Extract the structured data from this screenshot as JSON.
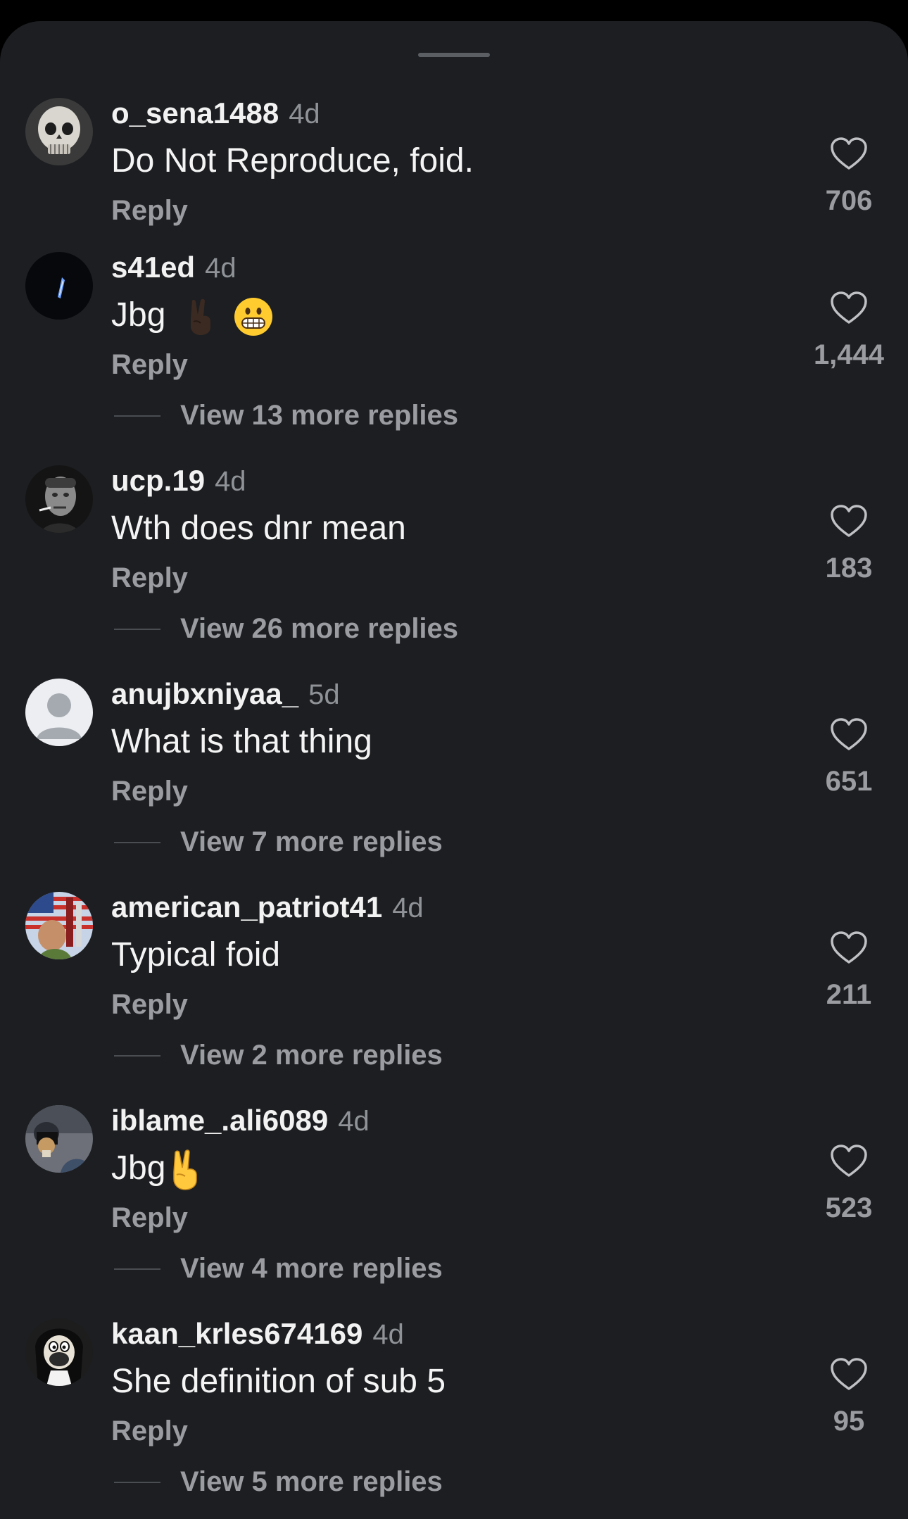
{
  "comments": [
    {
      "username": "o_sena1488",
      "age": "4d",
      "text": "Do Not Reproduce, foid.",
      "reply": "Reply",
      "likes": "706",
      "more": ""
    },
    {
      "username": "s41ed",
      "age": "4d",
      "text": "Jbg",
      "reply": "Reply",
      "likes": "1,444",
      "more": "View 13 more replies"
    },
    {
      "username": "ucp.19",
      "age": "4d",
      "text": "Wth does dnr mean",
      "reply": "Reply",
      "likes": "183",
      "more": "View 26 more replies"
    },
    {
      "username": "anujbxniyaa_",
      "age": "5d",
      "text": "What is that thing",
      "reply": "Reply",
      "likes": "651",
      "more": "View 7 more replies"
    },
    {
      "username": "american_patriot41",
      "age": "4d",
      "text": "Typical foid",
      "reply": "Reply",
      "likes": "211",
      "more": "View 2 more replies"
    },
    {
      "username": "iblame_.ali6089",
      "age": "4d",
      "text": "Jbg",
      "reply": "Reply",
      "likes": "523",
      "more": "View 4 more replies"
    },
    {
      "username": "kaan_krles674169",
      "age": "4d",
      "text": "She definition of sub 5",
      "reply": "Reply",
      "likes": "95",
      "more": "View 5 more replies"
    }
  ],
  "icons": {
    "like": "heart-outline-icon",
    "emoji_victory": "victory-hand-emoji",
    "emoji_grimace": "grimacing-face-emoji"
  }
}
